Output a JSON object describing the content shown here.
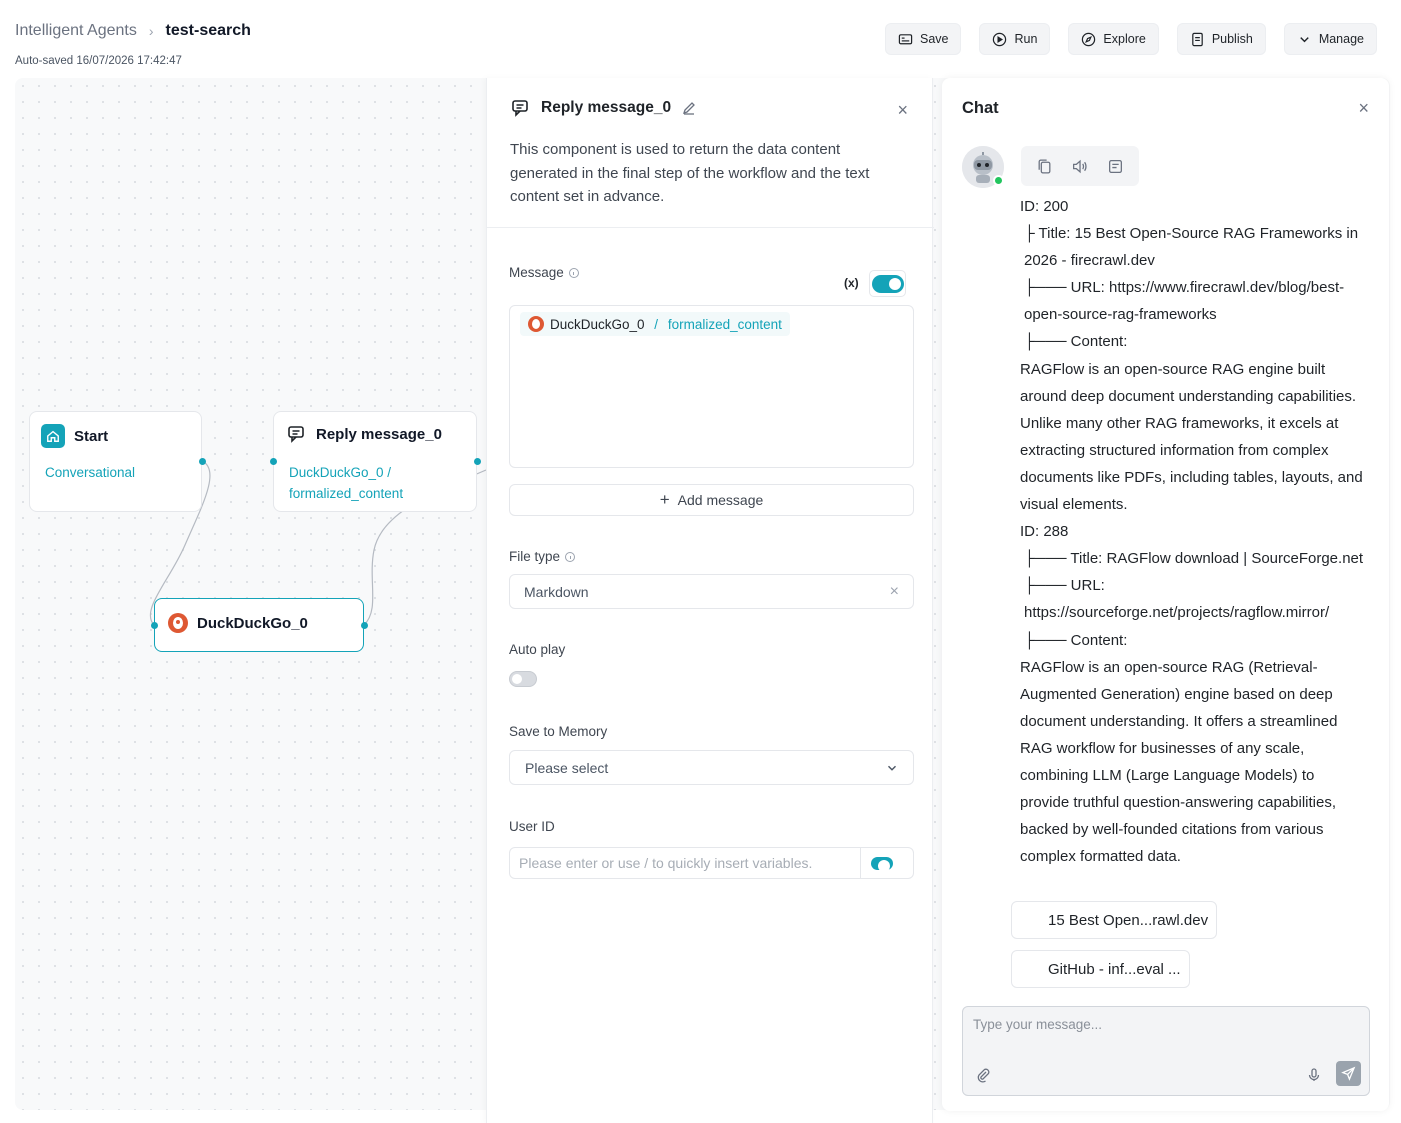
{
  "header": {
    "breadcrumb_root": "Intelligent Agents",
    "breadcrumb_sep": "›",
    "breadcrumb_current": "test-search",
    "autosaved": "Auto-saved 16/07/2026 17:42:47",
    "actions": {
      "save": "Save",
      "run": "Run",
      "explore": "Explore",
      "publish": "Publish",
      "manage": "Manage"
    }
  },
  "canvas": {
    "start_node": {
      "title": "Start",
      "subtitle": "Conversational"
    },
    "reply_node": {
      "title": "Reply message_0",
      "line1": "DuckDuckGo_0 /",
      "line2": "formalized_content"
    },
    "ddg_node": {
      "title": "DuckDuckGo_0"
    }
  },
  "props": {
    "title": "Reply message_0",
    "close": "×",
    "description": "This component is used to return the data content generated in the final step of the workflow and the text content set in advance.",
    "message_label": "Message",
    "var_button": "(x)",
    "message_var_source": "DuckDuckGo_0",
    "message_var_sep": " / ",
    "message_var_name": "formalized_content",
    "add_message": "Add message",
    "file_type_label": "File type",
    "file_type_value": "Markdown",
    "auto_play_label": "Auto play",
    "save_memory_label": "Save to Memory",
    "save_memory_placeholder": "Please select",
    "user_id_label": "User ID",
    "user_id_placeholder": "Please enter or use / to quickly insert variables."
  },
  "chat": {
    "title": "Chat",
    "close": "×",
    "lines": [
      "ID: 200",
      "├ Title: 15 Best Open-Source RAG Frameworks in 2026 - firecrawl.dev",
      "├─── URL: https://www.firecrawl.dev/blog/best-open-source-rag-frameworks",
      "├─── Content:",
      "RAGFlow is an open-source RAG engine built around deep document understanding capabilities. Unlike many other RAG frameworks, it excels at extracting structured information from complex documents like PDFs, including tables, layouts, and visual elements.",
      "ID: 288",
      "├─── Title: RAGFlow download | SourceForge.net",
      "├─── URL: https://sourceforge.net/projects/ragflow.mirror/",
      "├─── Content:",
      "RAGFlow is an open-source RAG (Retrieval-Augmented Generation) engine based on deep document understanding. It offers a streamlined RAG workflow for businesses of any scale, combining LLM (Large Language Models) to provide truthful question-answering capabilities, backed by well-founded citations from various complex formatted data."
    ],
    "references": [
      "15 Best Open...rawl.dev",
      "GitHub - inf...eval ..."
    ],
    "input_placeholder": "Type your message..."
  },
  "colors": {
    "accent": "#14a3b8",
    "ddg_orange": "#de5833"
  }
}
